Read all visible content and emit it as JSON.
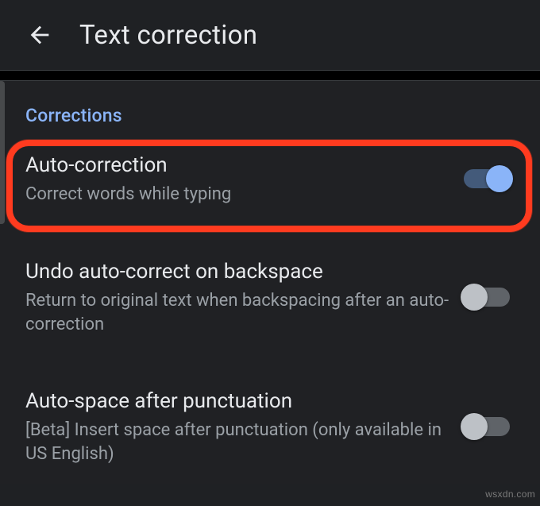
{
  "appbar": {
    "title": "Text correction"
  },
  "section": {
    "header": "Corrections"
  },
  "rows": {
    "auto_correction": {
      "title": "Auto-correction",
      "subtitle": "Correct words while typing",
      "enabled": true
    },
    "undo_backspace": {
      "title": "Undo auto-correct on backspace",
      "subtitle": "Return to original text when backspacing after an auto-correction",
      "enabled": false
    },
    "auto_space": {
      "title": "Auto-space after punctuation",
      "subtitle": "[Beta] Insert space after punctuation (only available in US English)",
      "enabled": false
    }
  },
  "watermark": "wsxdn.com"
}
